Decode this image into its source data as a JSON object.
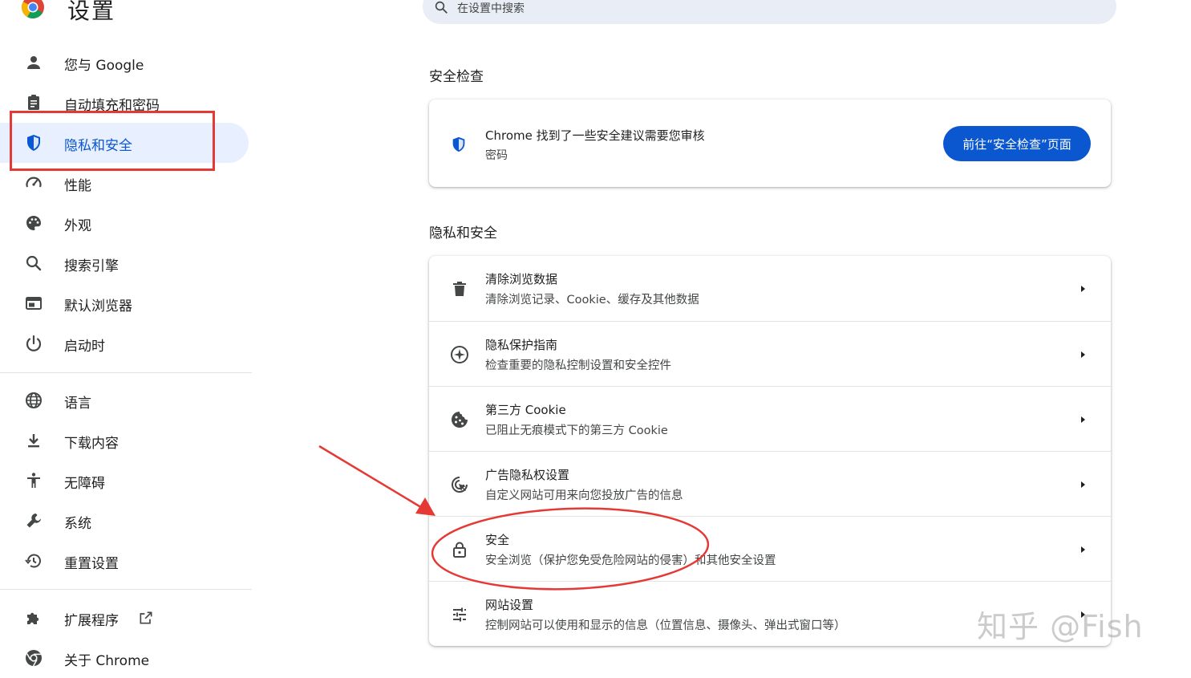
{
  "header": {
    "title": "设置",
    "search_placeholder": "在设置中搜索"
  },
  "sidebar": {
    "items": [
      {
        "label": "您与 Google",
        "icon": "person-icon"
      },
      {
        "label": "自动填充和密码",
        "icon": "clipboard-icon"
      },
      {
        "label": "隐私和安全",
        "icon": "shield-icon",
        "active": true
      },
      {
        "label": "性能",
        "icon": "speedometer-icon"
      },
      {
        "label": "外观",
        "icon": "palette-icon"
      },
      {
        "label": "搜索引擎",
        "icon": "search-icon"
      },
      {
        "label": "默认浏览器",
        "icon": "browser-window-icon"
      },
      {
        "label": "启动时",
        "icon": "power-icon"
      },
      {
        "label": "语言",
        "icon": "globe-icon"
      },
      {
        "label": "下载内容",
        "icon": "download-icon"
      },
      {
        "label": "无障碍",
        "icon": "accessibility-icon"
      },
      {
        "label": "系统",
        "icon": "wrench-icon"
      },
      {
        "label": "重置设置",
        "icon": "history-icon"
      },
      {
        "label": "扩展程序",
        "icon": "puzzle-icon"
      },
      {
        "label": "关于 Chrome",
        "icon": "chrome-icon"
      }
    ]
  },
  "safety_check": {
    "section_title": "安全检查",
    "message": "Chrome 找到了一些安全建议需要您审核",
    "detail": "密码",
    "button_label": "前往“安全检查”页面"
  },
  "privacy": {
    "section_title": "隐私和安全",
    "rows": [
      {
        "title": "清除浏览数据",
        "subtitle": "清除浏览记录、Cookie、缓存及其他数据",
        "icon": "trash-icon"
      },
      {
        "title": "隐私保护指南",
        "subtitle": "检查重要的隐私控制设置和安全控件",
        "icon": "compass-icon"
      },
      {
        "title": "第三方 Cookie",
        "subtitle": "已阻止无痕模式下的第三方 Cookie",
        "icon": "cookie-icon"
      },
      {
        "title": "广告隐私权设置",
        "subtitle": "自定义网站可用来向您投放广告的信息",
        "icon": "ad-privacy-icon"
      },
      {
        "title": "安全",
        "subtitle": "安全浏览（保护您免受危险网站的侵害）和其他安全设置",
        "icon": "lock-icon"
      },
      {
        "title": "网站设置",
        "subtitle": "控制网站可以使用和显示的信息（位置信息、摄像头、弹出式窗口等）",
        "icon": "sliders-icon"
      }
    ]
  },
  "colors": {
    "accent": "#0b57d0",
    "active_bg": "#e8effe",
    "annotation_red": "#e53935"
  },
  "watermark": "知乎 @Fish"
}
